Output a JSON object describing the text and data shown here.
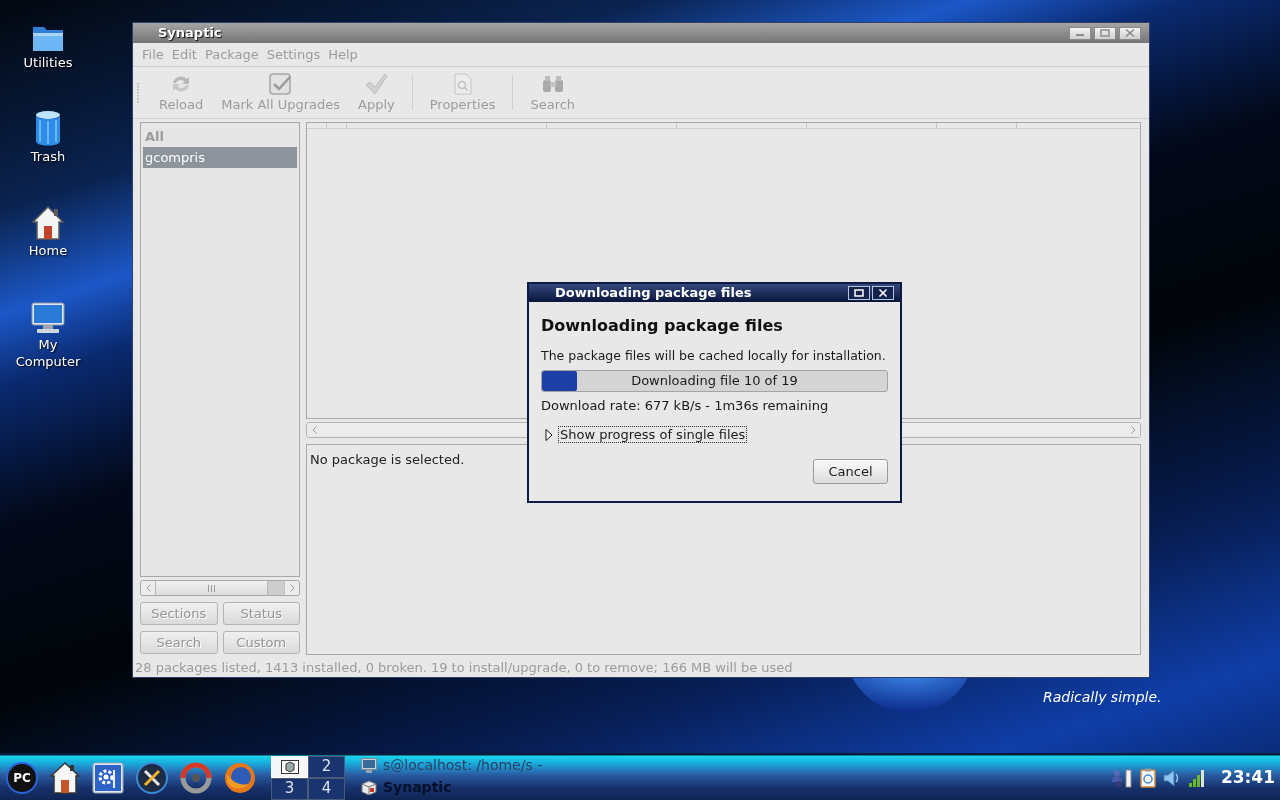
{
  "desktop_icons": [
    {
      "label": "Utilities",
      "kind": "folder"
    },
    {
      "label": "Trash",
      "kind": "trash"
    },
    {
      "label": "Home",
      "kind": "home"
    },
    {
      "label": "My Computer",
      "kind": "computer"
    }
  ],
  "wallpaper": {
    "tagline": "Radically simple."
  },
  "window": {
    "title": "Synaptic",
    "disabled": true,
    "menu": [
      "File",
      "Edit",
      "Package",
      "Settings",
      "Help"
    ],
    "toolbar": [
      {
        "kind": "reload",
        "label": "Reload"
      },
      {
        "kind": "upgrade",
        "label": "Mark All Upgrades"
      },
      {
        "kind": "apply",
        "label": "Apply"
      },
      {
        "kind": "separator"
      },
      {
        "kind": "properties",
        "label": "Properties"
      },
      {
        "kind": "separator"
      },
      {
        "kind": "search",
        "label": "Search"
      }
    ],
    "filters": [
      {
        "kind": "heading",
        "label": "All",
        "selected": false
      },
      {
        "kind": "item",
        "label": "gcompris",
        "selected": true
      }
    ],
    "filter_buttons": [
      "Sections",
      "Status",
      "Search",
      "Custom"
    ],
    "details_text": "No package is selected.",
    "status_bar": "28 packages listed, 1413 installed, 0 broken. 19 to install/upgrade, 0 to remove; 166 MB will be used"
  },
  "dialog": {
    "title": "Downloading package files",
    "heading": "Downloading package files",
    "message": "The package files will be cached locally for installation.",
    "progress": {
      "level": 0.1,
      "text": "Downloading file 10 of 19"
    },
    "rate": "Download rate: 677 kB/s - 1m36s remaining",
    "expander": {
      "label": "Show progress of single files",
      "expanded": false
    },
    "buttons": [
      "Cancel"
    ]
  },
  "taskbar": {
    "launchers": [
      {
        "kind": "pc",
        "label": "PC"
      },
      {
        "kind": "home"
      },
      {
        "kind": "control-panel"
      },
      {
        "kind": "tools"
      },
      {
        "kind": "ring"
      },
      {
        "kind": "browser"
      }
    ],
    "pager": [
      {
        "kind": "thumbnail",
        "selected": true
      },
      {
        "kind": "number",
        "label": "2",
        "selected": false
      },
      {
        "kind": "number",
        "label": "3",
        "selected": false
      },
      {
        "kind": "number",
        "label": "4",
        "selected": false
      }
    ],
    "tasks": [
      {
        "kind": "terminal",
        "label": "s@localhost: /home/s -",
        "minimized": true
      },
      {
        "kind": "synaptic",
        "label": "Synaptic",
        "minimized": false
      }
    ],
    "tray": [
      {
        "kind": "network"
      },
      {
        "kind": "clipboard"
      },
      {
        "kind": "volume"
      },
      {
        "kind": "signal"
      }
    ],
    "clock": "23:41"
  }
}
